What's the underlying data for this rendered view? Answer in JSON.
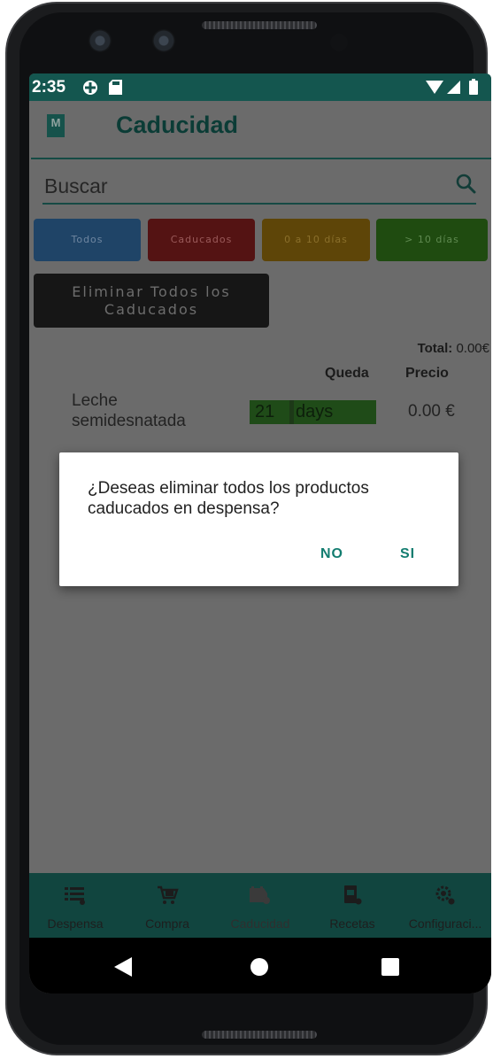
{
  "status_bar": {
    "time": "2:35"
  },
  "app": {
    "title": "Caducidad",
    "logo_letter": "M"
  },
  "search": {
    "placeholder": "Buscar"
  },
  "filters": [
    {
      "label": "Todos",
      "color": "#1f4467",
      "text_color": "#6f86a0"
    },
    {
      "label": "Caducados",
      "color": "#541313",
      "text_color": "#9a5a5a"
    },
    {
      "label": "0 a 10 días",
      "color": "#5e4508",
      "text_color": "#8a6f2b"
    },
    {
      "label": "> 10 días",
      "color": "#1f4b10",
      "text_color": "#5f8a50"
    }
  ],
  "delete_all_button": {
    "line1": "Eliminar Todos los",
    "line2": "Caducados"
  },
  "summary": {
    "total_label": "Total:",
    "total_value": "0.00€"
  },
  "table": {
    "col_remaining": "Queda",
    "col_price": "Precio",
    "rows": [
      {
        "name_line1": "Leche",
        "name_line2": "semidesnatada",
        "days": "21",
        "unit": "days",
        "price": "0.00 €"
      }
    ]
  },
  "dialog": {
    "message": "¿Deseas eliminar todos los productos caducados en despensa?",
    "no": "NO",
    "yes": "SI"
  },
  "bottom_nav": [
    {
      "label": "Despensa",
      "icon": "list-icon"
    },
    {
      "label": "Compra",
      "icon": "cart-icon"
    },
    {
      "label": "Caducidad",
      "icon": "calendar-icon"
    },
    {
      "label": "Recetas",
      "icon": "recipe-icon"
    },
    {
      "label": "Configuraci...",
      "icon": "settings-icon"
    }
  ],
  "colors": {
    "primary": "#14564f",
    "accent": "#137d70",
    "scrim_bg": "#6b6b6b"
  }
}
